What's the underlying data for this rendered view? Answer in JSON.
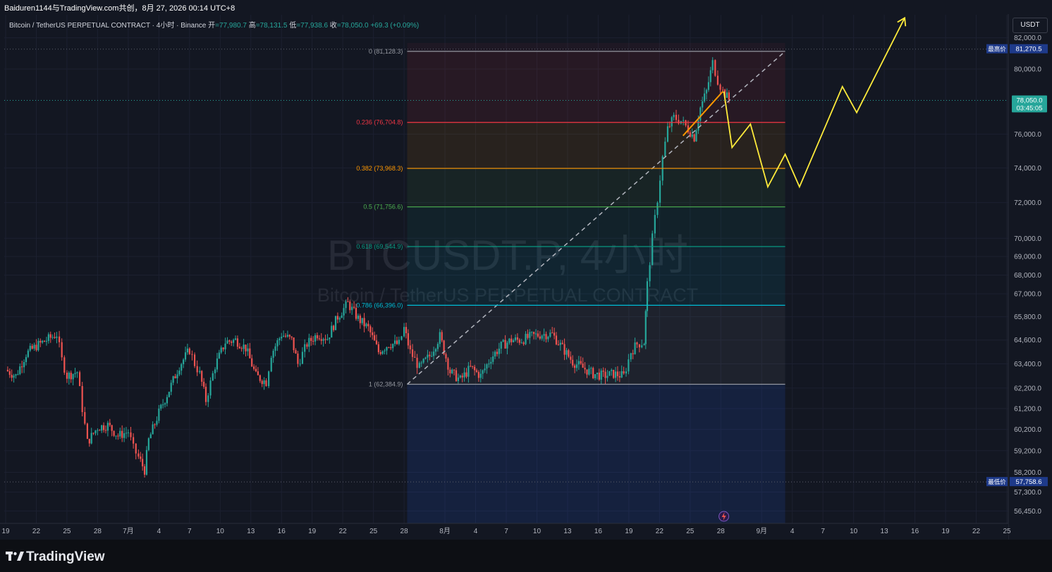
{
  "header": {
    "share_line": "Baiduren1144与TradingView.com共创，8月 27, 2026 00:14 UTC+8"
  },
  "legend": {
    "symbol": "Bitcoin / TetherUS PERPETUAL CONTRACT · 4小时 · Binance",
    "open_label": "开",
    "open_value": "=77,980.7",
    "high_label": "高",
    "high_value": "=78,131.5",
    "low_label": "低",
    "low_value": "=77,938.6",
    "close_label": "收",
    "close_value": "=78,050.0",
    "change": "+69.3 (+0.09%)"
  },
  "currency_button": "USDT",
  "watermark": {
    "line1": "BTCUSDT.P, 4小时",
    "line2": "Bitcoin / TetherUS PERPETUAL CONTRACT"
  },
  "footer": {
    "brand": "TradingView"
  },
  "colors": {
    "background": "#131722",
    "up": "#26a69a",
    "down": "#ef5350",
    "projection": "#ffeb3b",
    "trend": "#ff9800",
    "price_badge": "#26a69a",
    "extreme_badge": "#1e3a8a"
  },
  "chart_data": {
    "type": "candlestick",
    "symbol": "BTCUSDT.P",
    "timeframe": "4小时",
    "y_axis": {
      "scale": "log",
      "range": [
        55900,
        83500
      ],
      "ticks": [
        "82,000.0",
        "80,000.0",
        "76,000.0",
        "74,000.0",
        "72,000.0",
        "70,000.0",
        "69,000.0",
        "68,000.0",
        "67,000.0",
        "65,800.0",
        "64,600.0",
        "63,400.0",
        "62,200.0",
        "61,200.0",
        "60,200.0",
        "59,200.0",
        "58,200.0",
        "57,300.0",
        "56,450.0"
      ],
      "tick_values": [
        82000,
        80000,
        76000,
        74000,
        72000,
        70000,
        69000,
        68000,
        67000,
        65800,
        64600,
        63400,
        62200,
        61200,
        60200,
        59200,
        58200,
        57300,
        56450
      ]
    },
    "x_axis": {
      "labels": [
        "19",
        "22",
        "25",
        "28",
        "7月",
        "4",
        "7",
        "10",
        "13",
        "16",
        "19",
        "22",
        "25",
        "28",
        "8月",
        "4",
        "7",
        "10",
        "13",
        "16",
        "19",
        "22",
        "25",
        "28",
        "9月",
        "4",
        "7",
        "10",
        "13",
        "16",
        "19",
        "22",
        "25"
      ],
      "label_index": [
        0,
        3,
        6,
        9,
        12,
        15,
        18,
        21,
        24,
        27,
        30,
        33,
        36,
        39,
        43,
        46,
        49,
        52,
        55,
        58,
        61,
        64,
        67,
        70,
        74,
        77,
        80,
        83,
        86,
        89,
        92,
        95,
        98
      ],
      "index_range": [
        0,
        98
      ]
    },
    "price_path": [
      [
        0,
        63100
      ],
      [
        1,
        62800
      ],
      [
        2,
        63900
      ],
      [
        3,
        64300
      ],
      [
        4,
        64600
      ],
      [
        5,
        64900
      ],
      [
        5.5,
        63600
      ],
      [
        6,
        62800
      ],
      [
        7,
        63000
      ],
      [
        7.5,
        61200
      ],
      [
        8,
        59600
      ],
      [
        9,
        60300
      ],
      [
        10,
        60400
      ],
      [
        11,
        59900
      ],
      [
        12,
        60100
      ],
      [
        12.5,
        59300
      ],
      [
        13,
        58900
      ],
      [
        13.6,
        58300
      ],
      [
        14,
        59700
      ],
      [
        15,
        61000
      ],
      [
        16,
        62100
      ],
      [
        17,
        63300
      ],
      [
        18,
        64100
      ],
      [
        18.5,
        63400
      ],
      [
        19,
        62900
      ],
      [
        19.6,
        61600
      ],
      [
        20.5,
        63300
      ],
      [
        21.5,
        64500
      ],
      [
        22.5,
        64600
      ],
      [
        23.5,
        64200
      ],
      [
        24.5,
        62800
      ],
      [
        25.5,
        62500
      ],
      [
        26,
        63900
      ],
      [
        27,
        64900
      ],
      [
        28,
        64600
      ],
      [
        28.6,
        63400
      ],
      [
        29.5,
        64400
      ],
      [
        30.5,
        64900
      ],
      [
        31.5,
        64700
      ],
      [
        32.5,
        65800
      ],
      [
        33.5,
        66500
      ],
      [
        34.5,
        65700
      ],
      [
        35.5,
        65200
      ],
      [
        36.5,
        64000
      ],
      [
        37.5,
        64400
      ],
      [
        38.5,
        64400
      ],
      [
        39,
        65200
      ],
      [
        39.6,
        64000
      ],
      [
        40.5,
        63200
      ],
      [
        41.5,
        63800
      ],
      [
        42.5,
        64800
      ],
      [
        43.5,
        63000
      ],
      [
        44.5,
        62600
      ],
      [
        45.5,
        63200
      ],
      [
        46.5,
        62800
      ],
      [
        47.5,
        63700
      ],
      [
        48.5,
        64300
      ],
      [
        49.5,
        64600
      ],
      [
        50.5,
        64600
      ],
      [
        51.5,
        64800
      ],
      [
        52.5,
        64900
      ],
      [
        53.5,
        64900
      ],
      [
        54.5,
        64200
      ],
      [
        55.5,
        63500
      ],
      [
        56.5,
        63200
      ],
      [
        57.5,
        62900
      ],
      [
        58.5,
        62800
      ],
      [
        59.5,
        62900
      ],
      [
        60.5,
        62800
      ],
      [
        61.2,
        64000
      ],
      [
        61.8,
        64400
      ],
      [
        62.5,
        64500
      ],
      [
        62.8,
        67500
      ],
      [
        63.3,
        70000
      ],
      [
        63.8,
        72200
      ],
      [
        64.3,
        74600
      ],
      [
        64.8,
        76300
      ],
      [
        65.4,
        77000
      ],
      [
        66.1,
        76800
      ],
      [
        66.8,
        76300
      ],
      [
        67.4,
        75800
      ],
      [
        68,
        77600
      ],
      [
        68.6,
        78600
      ],
      [
        69.2,
        80400
      ],
      [
        69.7,
        79300
      ],
      [
        70.2,
        78600
      ],
      [
        70.8,
        78100
      ]
    ],
    "candles": [
      {
        "i": 3,
        "o": 64300,
        "h": 64800,
        "l": 63900,
        "c": 64600
      },
      {
        "i": 5,
        "o": 64700,
        "h": 65100,
        "l": 63400,
        "c": 63600
      },
      {
        "i": 8,
        "o": 59600,
        "h": 60300,
        "l": 58100,
        "c": 59100
      },
      {
        "i": 13.6,
        "o": 58900,
        "h": 59300,
        "l": 57900,
        "c": 58300
      },
      {
        "i": 14,
        "o": 58400,
        "h": 59900,
        "l": 58200,
        "c": 59700
      },
      {
        "i": 22,
        "o": 64400,
        "h": 65100,
        "l": 64300,
        "c": 64600
      },
      {
        "i": 33.5,
        "o": 66200,
        "h": 66900,
        "l": 65900,
        "c": 66500
      },
      {
        "i": 44.5,
        "o": 62800,
        "h": 63000,
        "l": 62300,
        "c": 62600
      },
      {
        "i": 62.8,
        "o": 64500,
        "h": 69800,
        "l": 64300,
        "c": 69200
      },
      {
        "i": 64.3,
        "o": 72300,
        "h": 76300,
        "l": 72100,
        "c": 74600
      },
      {
        "i": 69.2,
        "o": 79300,
        "h": 81270,
        "l": 78900,
        "c": 80400
      },
      {
        "i": 70.8,
        "o": 78200,
        "h": 78300,
        "l": 77900,
        "c": 78050
      }
    ],
    "highest_price": {
      "label": "最高价",
      "value": "81,270.5",
      "v": 81270.5
    },
    "lowest_price": {
      "label": "最低价",
      "value": "57,758.6",
      "v": 57758.6
    },
    "current_price": {
      "value": "78,050.0",
      "v": 78050,
      "countdown": "03:45:05"
    },
    "fibonacci": {
      "x_start_index": 39.3,
      "x_end_index": 76.3,
      "levels": [
        {
          "ratio": "0",
          "price": 81128.3,
          "label": "0 (81,128.3)",
          "color": "#9598a1"
        },
        {
          "ratio": "0.236",
          "price": 76704.8,
          "label": "0.236 (76,704.8)",
          "color": "#f23645"
        },
        {
          "ratio": "0.382",
          "price": 73968.3,
          "label": "0.382 (73,968.3)",
          "color": "#ff9800"
        },
        {
          "ratio": "0.5",
          "price": 71756.6,
          "label": "0.5 (71,756.6)",
          "color": "#4caf50"
        },
        {
          "ratio": "0.618",
          "price": 69544.9,
          "label": "0.618 (69,544.9)",
          "color": "#089981"
        },
        {
          "ratio": "0.786",
          "price": 66396.0,
          "label": "0.786 (66,396.0)",
          "color": "#00bcd4"
        },
        {
          "ratio": "1",
          "price": 62384.9,
          "label": "1 (62,384.9)",
          "color": "#9598a1"
        }
      ]
    },
    "trend_dashed": {
      "from": [
        39.3,
        62384.9
      ],
      "to": [
        76.3,
        81128.3
      ]
    },
    "trend_orange": {
      "from": [
        66.3,
        75900
      ],
      "to": [
        70.2,
        78600
      ]
    },
    "projection_path": [
      [
        70.3,
        78600
      ],
      [
        71.1,
        75200
      ],
      [
        72.9,
        76600
      ],
      [
        74.6,
        72900
      ],
      [
        76.3,
        74800
      ],
      [
        77.7,
        72900
      ],
      [
        81.9,
        78900
      ],
      [
        83.3,
        77300
      ],
      [
        88,
        83300
      ]
    ],
    "grid": true
  }
}
